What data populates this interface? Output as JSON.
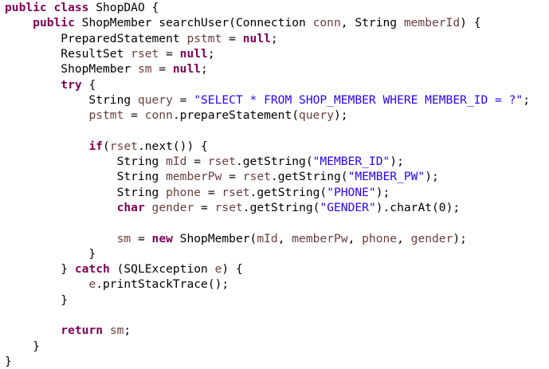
{
  "colors": {
    "background": "#ffffff",
    "keyword": "#7f0055",
    "local_variable": "#6a3e3e",
    "string": "#2a00ff",
    "text": "#000000"
  },
  "code": {
    "lines": [
      [
        [
          "kw",
          "public"
        ],
        [
          "plain",
          " "
        ],
        [
          "kw",
          "class"
        ],
        [
          "plain",
          " ShopDAO {"
        ]
      ],
      [
        [
          "plain",
          "    "
        ],
        [
          "kw",
          "public"
        ],
        [
          "plain",
          " ShopMember searchUser(Connection "
        ],
        [
          "var",
          "conn"
        ],
        [
          "plain",
          ", String "
        ],
        [
          "var",
          "memberId"
        ],
        [
          "plain",
          ") {"
        ]
      ],
      [
        [
          "plain",
          "        PreparedStatement "
        ],
        [
          "var",
          "pstmt"
        ],
        [
          "plain",
          " = "
        ],
        [
          "kw",
          "null"
        ],
        [
          "plain",
          ";"
        ]
      ],
      [
        [
          "plain",
          "        ResultSet "
        ],
        [
          "var",
          "rset"
        ],
        [
          "plain",
          " = "
        ],
        [
          "kw",
          "null"
        ],
        [
          "plain",
          ";"
        ]
      ],
      [
        [
          "plain",
          "        ShopMember "
        ],
        [
          "var",
          "sm"
        ],
        [
          "plain",
          " = "
        ],
        [
          "kw",
          "null"
        ],
        [
          "plain",
          ";"
        ]
      ],
      [
        [
          "plain",
          "        "
        ],
        [
          "kw",
          "try"
        ],
        [
          "plain",
          " {"
        ]
      ],
      [
        [
          "plain",
          "            String "
        ],
        [
          "var",
          "query"
        ],
        [
          "plain",
          " = "
        ],
        [
          "str",
          "\"SELECT * FROM SHOP_MEMBER WHERE MEMBER_ID = ?\""
        ],
        [
          "plain",
          ";"
        ]
      ],
      [
        [
          "plain",
          "            "
        ],
        [
          "var",
          "pstmt"
        ],
        [
          "plain",
          " = "
        ],
        [
          "var",
          "conn"
        ],
        [
          "plain",
          ".prepareStatement("
        ],
        [
          "var",
          "query"
        ],
        [
          "plain",
          ");"
        ]
      ],
      [],
      [
        [
          "plain",
          "            "
        ],
        [
          "kw",
          "if"
        ],
        [
          "plain",
          "("
        ],
        [
          "var",
          "rset"
        ],
        [
          "plain",
          ".next()) {"
        ]
      ],
      [
        [
          "plain",
          "                String "
        ],
        [
          "var",
          "mId"
        ],
        [
          "plain",
          " = "
        ],
        [
          "var",
          "rset"
        ],
        [
          "plain",
          ".getString("
        ],
        [
          "str",
          "\"MEMBER_ID\""
        ],
        [
          "plain",
          ");"
        ]
      ],
      [
        [
          "plain",
          "                String "
        ],
        [
          "var",
          "memberPw"
        ],
        [
          "plain",
          " = "
        ],
        [
          "var",
          "rset"
        ],
        [
          "plain",
          ".getString("
        ],
        [
          "str",
          "\"MEMBER_PW\""
        ],
        [
          "plain",
          ");"
        ]
      ],
      [
        [
          "plain",
          "                String "
        ],
        [
          "var",
          "phone"
        ],
        [
          "plain",
          " = "
        ],
        [
          "var",
          "rset"
        ],
        [
          "plain",
          ".getString("
        ],
        [
          "str",
          "\"PHONE\""
        ],
        [
          "plain",
          ");"
        ]
      ],
      [
        [
          "plain",
          "                "
        ],
        [
          "kw",
          "char"
        ],
        [
          "plain",
          " "
        ],
        [
          "var",
          "gender"
        ],
        [
          "plain",
          " = "
        ],
        [
          "var",
          "rset"
        ],
        [
          "plain",
          ".getString("
        ],
        [
          "str",
          "\"GENDER\""
        ],
        [
          "plain",
          ").charAt(0);"
        ]
      ],
      [],
      [
        [
          "plain",
          "                "
        ],
        [
          "var",
          "sm"
        ],
        [
          "plain",
          " = "
        ],
        [
          "kw",
          "new"
        ],
        [
          "plain",
          " ShopMember("
        ],
        [
          "var",
          "mId"
        ],
        [
          "plain",
          ", "
        ],
        [
          "var",
          "memberPw"
        ],
        [
          "plain",
          ", "
        ],
        [
          "var",
          "phone"
        ],
        [
          "plain",
          ", "
        ],
        [
          "var",
          "gender"
        ],
        [
          "plain",
          ");"
        ]
      ],
      [
        [
          "plain",
          "            }"
        ]
      ],
      [
        [
          "plain",
          "        } "
        ],
        [
          "kw",
          "catch"
        ],
        [
          "plain",
          " (SQLException "
        ],
        [
          "var",
          "e"
        ],
        [
          "plain",
          ") {"
        ]
      ],
      [
        [
          "plain",
          "            "
        ],
        [
          "var",
          "e"
        ],
        [
          "plain",
          ".printStackTrace();"
        ]
      ],
      [
        [
          "plain",
          "        }"
        ]
      ],
      [],
      [
        [
          "plain",
          "        "
        ],
        [
          "kw",
          "return"
        ],
        [
          "plain",
          " "
        ],
        [
          "var",
          "sm"
        ],
        [
          "plain",
          ";"
        ]
      ],
      [
        [
          "plain",
          "    }"
        ]
      ],
      [
        [
          "plain",
          "}"
        ]
      ]
    ]
  }
}
